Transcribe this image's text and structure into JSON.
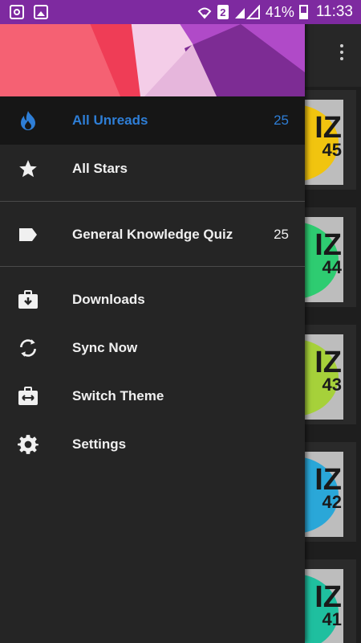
{
  "status_bar": {
    "sim_slot": "2",
    "battery_percent": "41%",
    "time": "11:33",
    "icons": [
      "instagram-icon",
      "gallery-icon",
      "wifi-icon",
      "signal-icon",
      "battery-icon"
    ]
  },
  "drawer": {
    "primary_items": [
      {
        "label": "All Unreads",
        "count": "25",
        "icon": "fire-icon",
        "active": true
      },
      {
        "label": "All Stars",
        "count": "",
        "icon": "star-icon",
        "active": false
      }
    ],
    "labels": [
      {
        "label": "General Knowledge Quiz",
        "count": "25",
        "icon": "label-icon"
      }
    ],
    "actions": [
      {
        "label": "Downloads",
        "icon": "download-box-icon"
      },
      {
        "label": "Sync Now",
        "icon": "sync-icon"
      },
      {
        "label": "Switch Theme",
        "icon": "theme-switch-icon"
      },
      {
        "label": "Settings",
        "icon": "gear-icon"
      }
    ]
  },
  "background_list": {
    "cards": [
      {
        "number": "45",
        "color": "#f1c40f"
      },
      {
        "number": "44",
        "color": "#2ecc71"
      },
      {
        "number": "43",
        "color": "#a6d13a"
      },
      {
        "number": "42",
        "color": "#2aa7d8"
      },
      {
        "number": "41",
        "color": "#1fbf9f"
      }
    ]
  },
  "colors": {
    "accent": "#2e7ed6",
    "status_bar": "#7e2aa0",
    "drawer_bg": "#252525"
  }
}
